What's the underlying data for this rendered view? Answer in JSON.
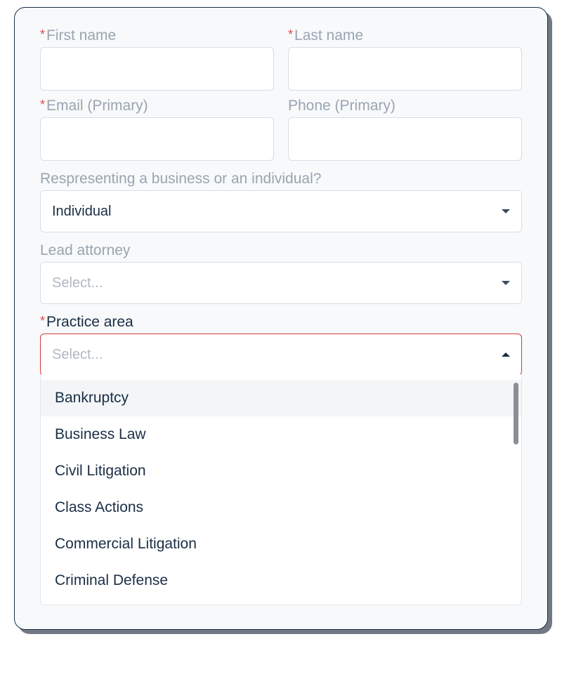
{
  "fields": {
    "first_name": {
      "label": "First name",
      "required": true
    },
    "last_name": {
      "label": "Last name",
      "required": true
    },
    "email": {
      "label": "Email (Primary)",
      "required": true
    },
    "phone": {
      "label": "Phone (Primary)",
      "required": false
    },
    "representing": {
      "label": "Respresenting a business or an individual?",
      "value": "Individual"
    },
    "lead_attorney": {
      "label": "Lead attorney",
      "placeholder": "Select..."
    },
    "practice_area": {
      "label": "Practice area",
      "required": true,
      "placeholder": "Select..."
    }
  },
  "practice_area_options": [
    "Bankruptcy",
    "Business Law",
    "Civil Litigation",
    "Class Actions",
    "Commercial Litigation",
    "Criminal Defense"
  ]
}
